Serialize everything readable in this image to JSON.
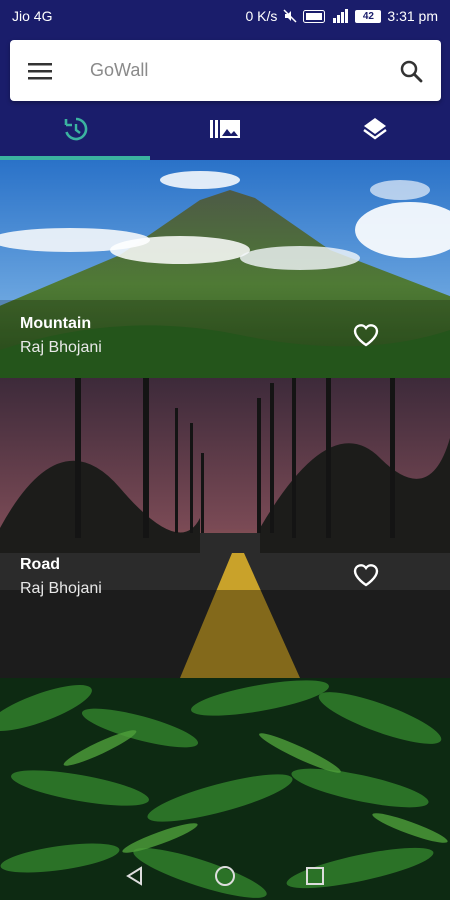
{
  "status_bar": {
    "carrier": "Jio 4G",
    "data_rate": "0 K/s",
    "volte": "VoLTE",
    "signal": "4G",
    "battery": "42",
    "time": "3:31 pm"
  },
  "app_bar": {
    "title": "GoWall",
    "accent_color": "#1a1d6b",
    "tab_indicator_color": "#3bb3a0"
  },
  "tabs": [
    {
      "icon": "history-icon",
      "selected": true
    },
    {
      "icon": "gallery-icon",
      "selected": false
    },
    {
      "icon": "layers-icon",
      "selected": false
    }
  ],
  "cards": [
    {
      "title": "Mountain",
      "author": "Raj Bhojani",
      "icon": "heart-outline-icon"
    },
    {
      "title": "Road",
      "author": "Raj Bhojani",
      "icon": "heart-outline-icon"
    },
    {
      "image": "green-fern-foliage"
    }
  ],
  "nav_bar": [
    "back-icon",
    "home-icon",
    "recents-icon"
  ]
}
